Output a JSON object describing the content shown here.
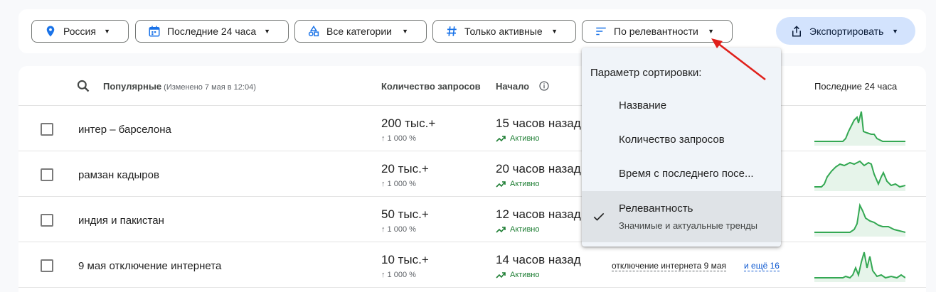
{
  "filters": [
    {
      "label": "Россия",
      "icon": "location-pin-icon"
    },
    {
      "label": "Последние 24 часа",
      "icon": "calendar-icon"
    },
    {
      "label": "Все категории",
      "icon": "categories-icon"
    },
    {
      "label": "Только активные",
      "icon": "hashtag-icon"
    },
    {
      "label": "По релевантности",
      "icon": "sort-icon"
    }
  ],
  "export_label": "Экспортировать",
  "table": {
    "headers": {
      "popular": "Популярные",
      "modified": "(Изменено 7 мая в 12:04)",
      "volume": "Количество запросов",
      "start": "Начало",
      "last24": "Последние 24 часа"
    },
    "rows": [
      {
        "term": "интер – барселона",
        "volume": "200 тыс.+",
        "growth": "↑ 1 000 %",
        "started": "15 часов назад",
        "status": "Активно"
      },
      {
        "term": "рамзан кадыров",
        "volume": "20 тыс.+",
        "growth": "↑ 1 000 %",
        "started": "20 часов назад",
        "status": "Активно"
      },
      {
        "term": "индия и пакистан",
        "volume": "50 тыс.+",
        "growth": "↑ 1 000 %",
        "started": "12 часов назад",
        "status": "Активно"
      },
      {
        "term": "9 мая отключение интернета",
        "volume": "10 тыс.+",
        "growth": "↑ 1 000 %",
        "started": "14 часов назад",
        "status": "Активно"
      }
    ],
    "related_term": "отключение интернета 9 мая",
    "more_link": "и ещё 16"
  },
  "sort_menu": {
    "title": "Параметр сортировки:",
    "items": [
      {
        "label": "Название"
      },
      {
        "label": "Количество запросов"
      },
      {
        "label": "Время с последнего посе..."
      },
      {
        "label": "Релевантность",
        "sub": "Значимые и актуальные тренды",
        "selected": true
      }
    ]
  },
  "colors": {
    "accent_blue": "#0b57d0",
    "export_bg": "#d3e3fd",
    "trend_green": "#34a853",
    "active_green": "#1e7e34",
    "annotation_red": "#e0201b"
  }
}
